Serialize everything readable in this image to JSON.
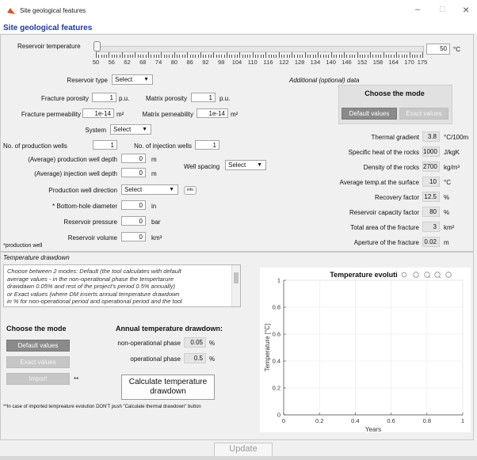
{
  "window": {
    "title": "Site geological features",
    "minimize": "–",
    "maximize": "□",
    "close": "×"
  },
  "heading": "Site geological features",
  "temp": {
    "label": "Reservoir temperature",
    "value": "50",
    "unit": "°C",
    "slider_level": 0.0,
    "tick_labels": [
      "50",
      "56",
      "62",
      "68",
      "74",
      "80",
      "86",
      "92",
      "98",
      "104",
      "110",
      "116",
      "122",
      "128",
      "134",
      "140",
      "146",
      "152",
      "158",
      "164",
      "170",
      "175"
    ]
  },
  "left": {
    "reservoir_type_label": "Reservoir type",
    "reservoir_type_value": "Select",
    "fracture_porosity_label": "Fracture porosity",
    "fracture_porosity_value": "1",
    "fracture_porosity_unit": "p.u.",
    "matrix_porosity_label": "Matrix porosity",
    "matrix_porosity_value": "1",
    "matrix_porosity_unit": "p.u.",
    "fracture_perm_label": "Fracture permeability",
    "fracture_perm_value": "1e-14",
    "fracture_perm_unit": "m²",
    "matrix_perm_label": "Matrix pemeability",
    "matrix_perm_value": "1e-14",
    "matrix_perm_unit": "m²",
    "system_label": "System",
    "system_value": "Select",
    "prod_wells_label": "No. of production wells",
    "prod_wells_value": "1",
    "inj_wells_label": "No. of injection wells",
    "inj_wells_value": "1",
    "prod_depth_label": "(Average) production well depth",
    "prod_depth_value": "0",
    "prod_depth_unit": "m",
    "inj_depth_label": "(Average) injection well depth",
    "inj_depth_value": "0",
    "inj_depth_unit": "m",
    "spacing_label": "Well spacing",
    "spacing_value": "Select",
    "direction_label": "Production well direction",
    "direction_value": "Select",
    "info_label": "info",
    "diameter_label": "* Bottom-hole diameter",
    "diameter_value": "0",
    "diameter_unit": "in",
    "pressure_label": "Reservoir pressure",
    "pressure_value": "0",
    "pressure_unit": "bar",
    "volume_label": "Reservoir volume",
    "volume_value": "0",
    "volume_unit": "km³",
    "footnote": "*production well"
  },
  "right": {
    "section_label": "Additional (optional) data",
    "mode_title": "Choose the mode",
    "default_btn": "Default values",
    "exact_btn": "Exact values",
    "rows": [
      {
        "label": "Thermal gradient",
        "value": "3.8",
        "unit": "°C/100m"
      },
      {
        "label": "Specific heat of the rocks",
        "value": "1000",
        "unit": "J/kgK"
      },
      {
        "label": "Density of the rocks",
        "value": "2700",
        "unit": "kg/m³"
      },
      {
        "label": "Average temp.at the surface",
        "value": "10",
        "unit": "°C"
      },
      {
        "label": "Recovery factor",
        "value": "12.5",
        "unit": "%"
      },
      {
        "label": "Reservoir capacity factor",
        "value": "80",
        "unit": "%"
      },
      {
        "label": "Total area of the fracture",
        "value": "3",
        "unit": "km²"
      },
      {
        "label": "Aperture of the fracture",
        "value": "0.02",
        "unit": "m"
      }
    ]
  },
  "drawdown": {
    "section_label": "Temperature drawdown",
    "desc": [
      "Choose between 2 modes: Default (the tool calculates with default",
      "average values - in the non-operational phase the tempertarure",
      "drawdawn 0.05% and rest of the project's period 0.5% annually)",
      "or Exact values (where DM inserts annual temperature drawdown",
      "in % for non-operational period and operational period and the tool"
    ],
    "mode_title": "Choose the mode",
    "default_btn": "Default values",
    "exact_btn": "Exact values",
    "import_btn": "Import",
    "import_mark": "**",
    "annual_title": "Annual temperature drawdown:",
    "nonop_label": "non-operational phase",
    "nonop_value": "0.05",
    "nonop_unit": "%",
    "op_label": "operational phase",
    "op_value": "0.5",
    "op_unit": "%",
    "calc_btn_line1": "Calculate temperature",
    "calc_btn_line2": "drawdown",
    "footnote": "**In case of imported tempreature evolution DON'T push \"Calculate thermal drawdown\" button"
  },
  "chart_data": {
    "type": "line",
    "title": "Temperature evoluti",
    "xlabel": "Years",
    "ylabel": "Temperature [°C]",
    "xlim": [
      0,
      1
    ],
    "ylim": [
      0,
      1
    ],
    "x_ticks": [
      "0",
      "0.2",
      "0.4",
      "0.6",
      "0.8",
      "1"
    ],
    "y_ticks": [
      "0",
      "0.2",
      "0.4",
      "0.6",
      "0.8",
      "1"
    ],
    "series": [],
    "grid": true
  },
  "update_btn": "Update"
}
